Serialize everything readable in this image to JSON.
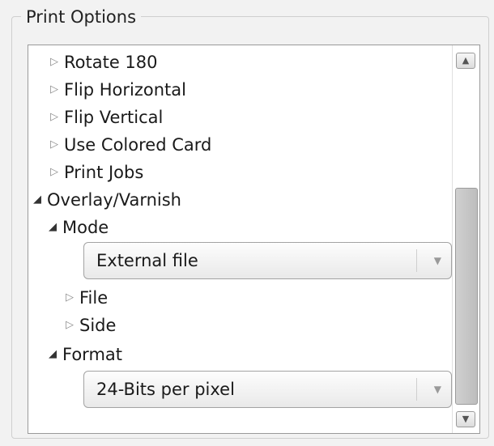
{
  "group": {
    "title": "Print Options"
  },
  "tree": {
    "rotate_180": {
      "label": "Rotate 180",
      "expander": "▷"
    },
    "flip_horizontal": {
      "label": "Flip Horizontal",
      "expander": "▷"
    },
    "flip_vertical": {
      "label": "Flip Vertical",
      "expander": "▷"
    },
    "use_colored_card": {
      "label": "Use Colored Card",
      "expander": "▷"
    },
    "print_jobs": {
      "label": "Print Jobs",
      "expander": "▷"
    },
    "overlay_varnish": {
      "label": "Overlay/Varnish",
      "expander": "◢"
    },
    "mode": {
      "label": "Mode",
      "expander": "◢"
    },
    "mode_combo": {
      "value": "External file",
      "arrow": "▼"
    },
    "file": {
      "label": "File",
      "expander": "▷"
    },
    "side": {
      "label": "Side",
      "expander": "▷"
    },
    "format": {
      "label": "Format",
      "expander": "◢"
    },
    "format_combo": {
      "value": "24-Bits per pixel",
      "arrow": "▼"
    }
  },
  "scrollbar": {
    "up_arrow": "▲",
    "down_arrow": "▼",
    "position": 0.36
  }
}
